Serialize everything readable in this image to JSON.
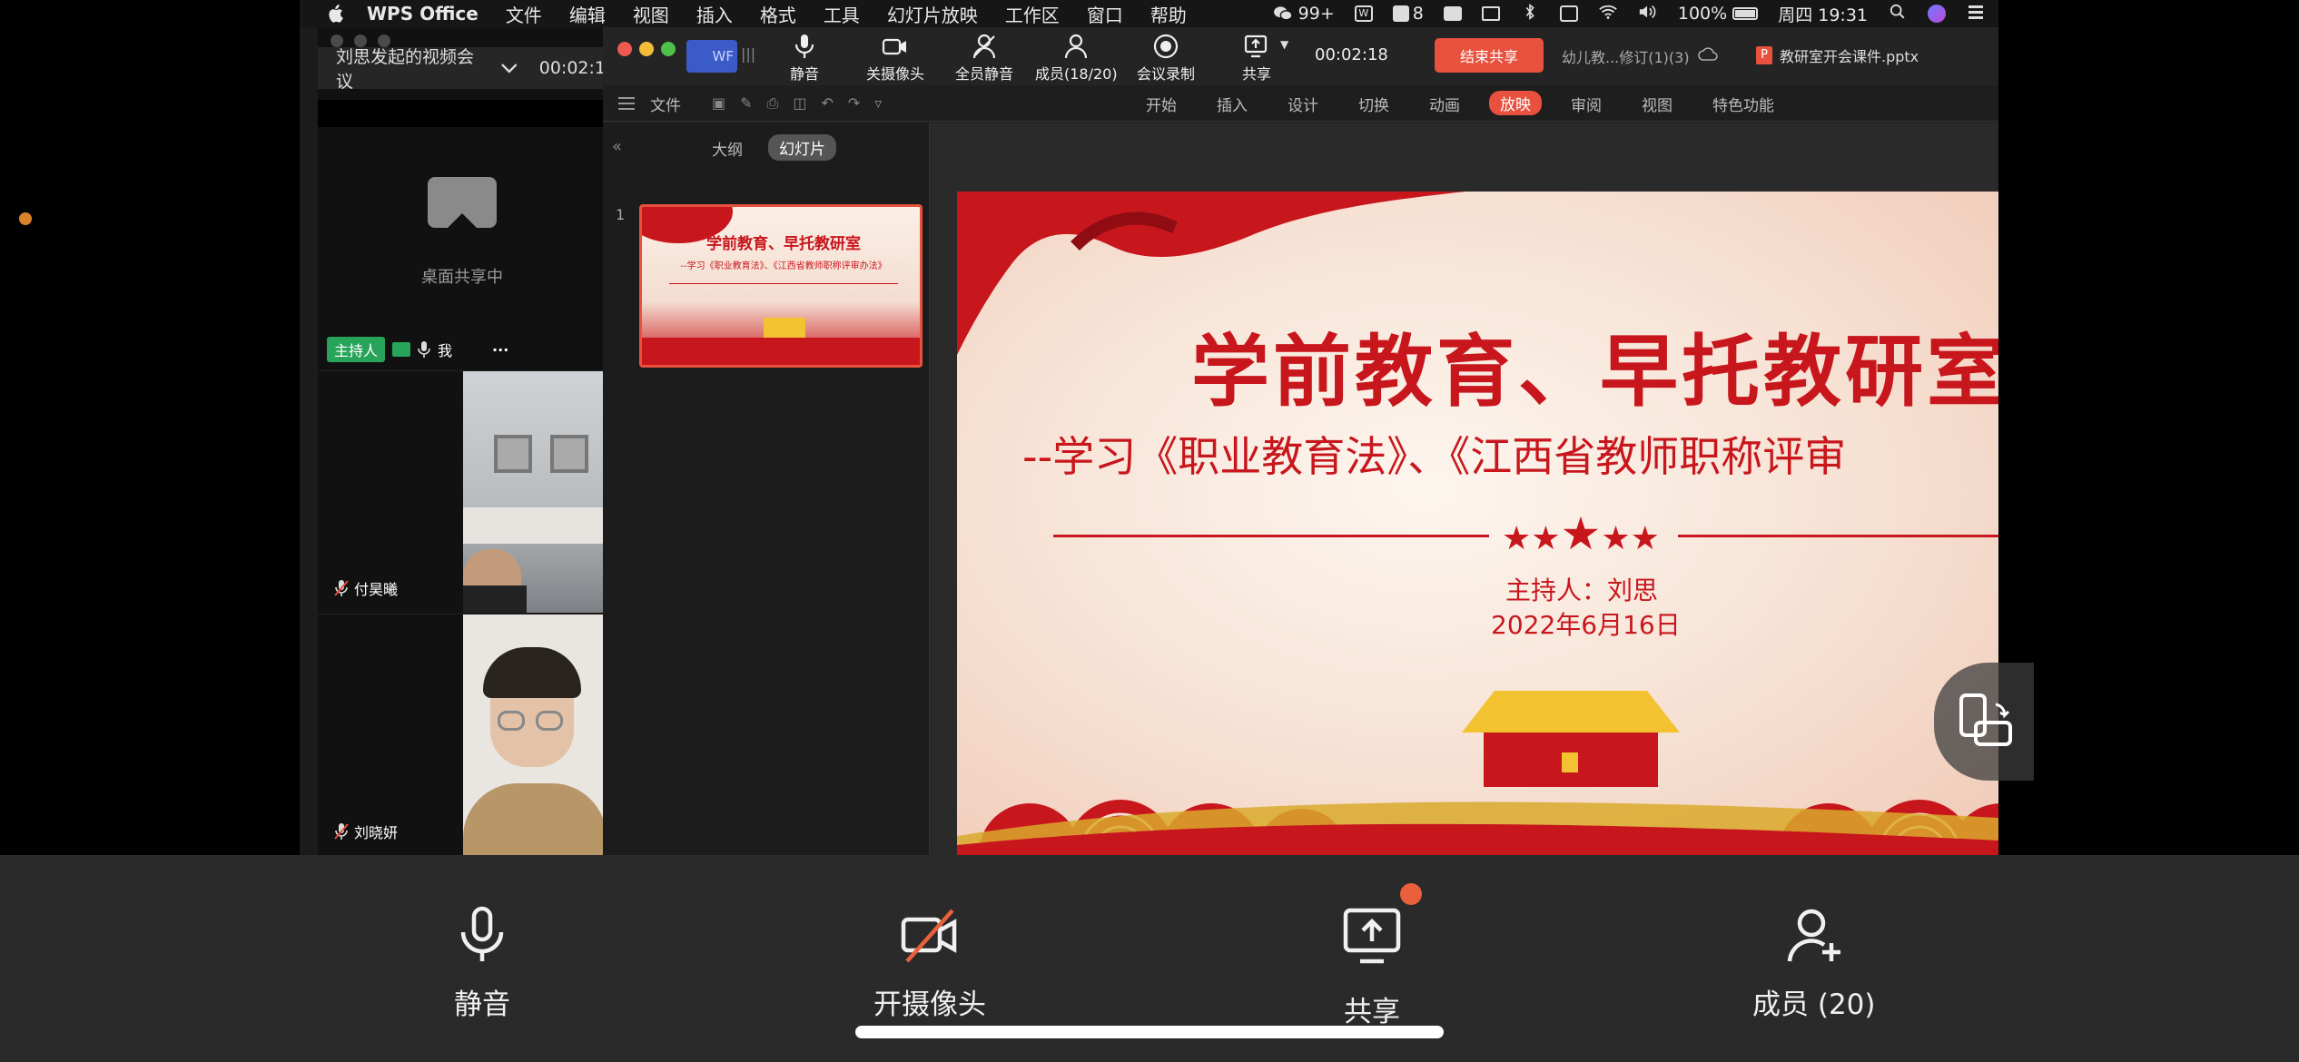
{
  "menubar": {
    "app_name": "WPS Office",
    "items": [
      "文件",
      "编辑",
      "视图",
      "插入",
      "格式",
      "工具",
      "幻灯片放映",
      "工作区",
      "窗口",
      "帮助"
    ],
    "status": {
      "wechat_badge": "99+",
      "notify_count": "8",
      "battery": "100%",
      "clock": "周四 19:31"
    }
  },
  "meeting_panel": {
    "title": "刘思发起的视频会议",
    "timer": "00:02:1",
    "share_status": "桌面共享中",
    "host_tag": "主持人",
    "me_label": "我",
    "more": "···",
    "participants": [
      {
        "name": "付昊曦"
      },
      {
        "name": "刘晓妍"
      }
    ]
  },
  "wps_meetbar": {
    "app_tab": "WF",
    "buttons": [
      {
        "label": "静音",
        "icon": "mic-icon"
      },
      {
        "label": "关摄像头",
        "icon": "camera-icon"
      },
      {
        "label": "全员静音",
        "icon": "mute-all-icon"
      },
      {
        "label": "成员(18/20)",
        "icon": "members-icon"
      },
      {
        "label": "会议录制",
        "icon": "record-icon"
      },
      {
        "label": "共享",
        "icon": "share-icon"
      }
    ],
    "timer": "00:02:18",
    "end_share": "结束共享",
    "doc_tab_1": "幼儿教...修订(1)(3)",
    "doc_tab_2": "教研室开会课件.pptx"
  },
  "ribbon": {
    "file": "文件",
    "tabs": [
      "开始",
      "插入",
      "设计",
      "切换",
      "动画",
      "放映",
      "审阅",
      "视图",
      "特色功能"
    ],
    "active_tab": "放映"
  },
  "slide_pane": {
    "tab_outline": "大纲",
    "tab_slides": "幻灯片",
    "slide_number": "1"
  },
  "slide": {
    "title": "学前教育、早托教研室",
    "subtitle": "--学习《职业教育法》、《江西省教师职称评审",
    "host": "主持人：刘思",
    "date": "2022年6月16日",
    "thumb_title": "学前教育、早托教研室",
    "thumb_subtitle": "--学习《职业教育法》、《江西省教师职称评审办法》"
  },
  "controls": {
    "mute": "静音",
    "camera": "开摄像头",
    "share": "共享",
    "members": "成员 (20)"
  },
  "colors": {
    "accent_red": "#e8513e",
    "host_green": "#27a35a",
    "slide_red": "#c8161d",
    "slide_gold": "#f2c230"
  }
}
